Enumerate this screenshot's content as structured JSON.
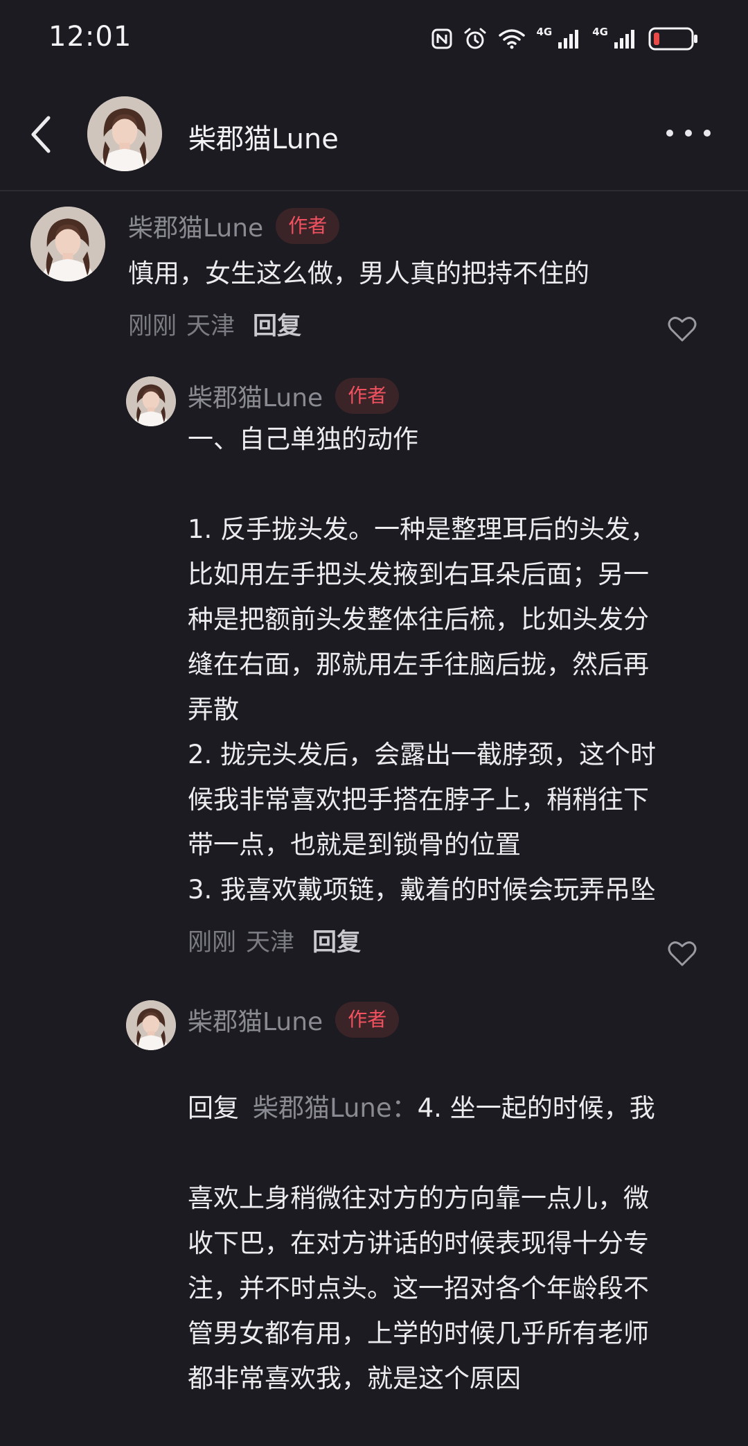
{
  "status_bar": {
    "time": "12:01",
    "network_1": "4G",
    "network_2": "4G",
    "icons": [
      "nfc-icon",
      "alarm-icon",
      "wifi-icon",
      "signal-icon",
      "signal-icon",
      "battery-low-icon"
    ],
    "battery_color": "#e94a47"
  },
  "header": {
    "title": "柴郡猫Lune",
    "back_icon": "chevron-left-icon",
    "more_icon": "more-horizontal-icon"
  },
  "colors": {
    "background": "#1b1b21",
    "badge_bg": "#3b2428",
    "badge_text": "#f25260",
    "name_text": "#8a8a92"
  },
  "comments": [
    {
      "name": "柴郡猫Lune",
      "badge": "作者",
      "text": "慎用，女生这么做，男人真的把持不住的",
      "time": "刚刚",
      "location": "天津",
      "reply_label": "回复",
      "like_icon": "heart-outline-icon"
    },
    {
      "name": "柴郡猫Lune",
      "badge": "作者",
      "text": "一、自己单独的动作\n\n1. 反手拢头发。一种是整理耳后的头发，\n比如用左手把头发掖到右耳朵后面；另一\n种是把额前头发整体往后梳，比如头发分\n缝在右面，那就用左手往脑后拢，然后再\n弄散\n2. 拢完头发后，会露出一截脖颈，这个时\n候我非常喜欢把手搭在脖子上，稍稍往下\n带一点，也就是到锁骨的位置\n3. 我喜欢戴项链，戴着的时候会玩弄吊坠",
      "time": "刚刚",
      "location": "天津",
      "reply_label": "回复",
      "like_icon": "heart-outline-icon"
    },
    {
      "name": "柴郡猫Lune",
      "badge": "作者",
      "reply_prefix": "回复",
      "reply_target": "柴郡猫Lune：",
      "text_first": "4. 坐一起的时候，我",
      "text": "喜欢上身稍微往对方的方向靠一点儿，微\n收下巴，在对方讲话的时候表现得十分专\n注，并不时点头。这一招对各个年龄段不\n管男女都有用，上学的时候几乎所有老师\n都非常喜欢我，就是这个原因"
    }
  ]
}
